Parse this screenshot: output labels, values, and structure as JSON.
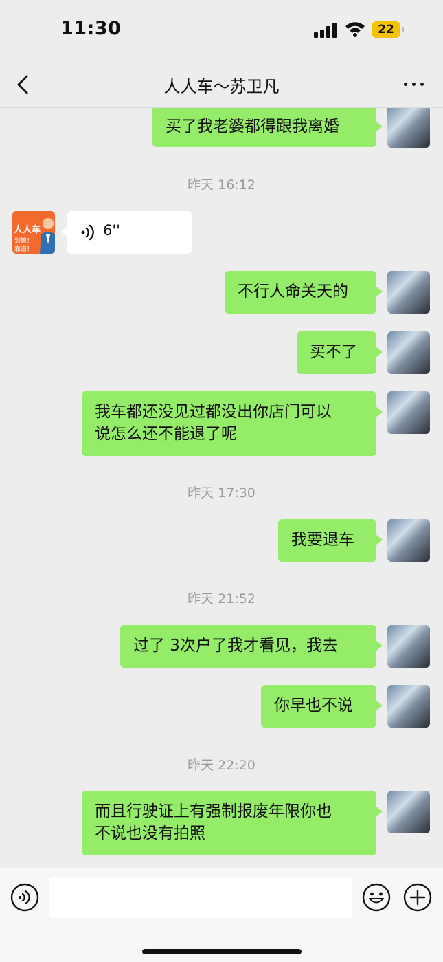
{
  "status_bar": {
    "time": "11:30",
    "battery": "22"
  },
  "nav": {
    "title": "人人车～苏卫凡"
  },
  "shop_avatar": {
    "brand": "人人车",
    "line1": "划算！",
    "line2": "靠谱！"
  },
  "messages": {
    "m0": "买了我老婆都得跟我离婚",
    "ts1": "昨天 16:12",
    "voice_duration": "6''",
    "m2": "不行人命关天的",
    "m3": "买不了",
    "m4_line1": "我车都还没见过都没出你店门可以",
    "m4_line2": "说怎么还不能退了呢",
    "ts2": "昨天 17:30",
    "m5": "我要退车",
    "ts3": "昨天 21:52",
    "m6": "过了 3次户了我才看见，我去",
    "m7": "你早也不说",
    "ts4": "昨天 22:20",
    "m8_line1": "而且行驶证上有强制报废年限你也",
    "m8_line2": "不说也没有拍照"
  },
  "icons": {
    "back": "chevron-left-icon",
    "more": "more-dots-icon",
    "voice": "voice-icon",
    "emoji": "emoji-icon",
    "add": "plus-icon"
  },
  "colors": {
    "my_bubble": "#95ec69",
    "their_bubble": "#ffffff",
    "background": "#ededed",
    "battery": "#f5c400"
  }
}
